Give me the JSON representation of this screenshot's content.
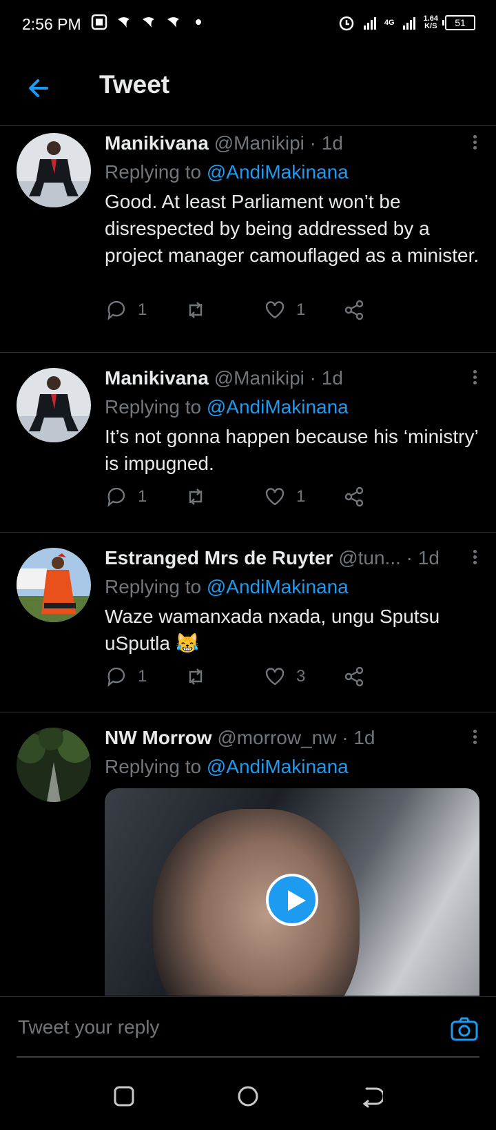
{
  "status_bar": {
    "time": "2:56 PM",
    "network": "4G",
    "speed_value": "1.64",
    "speed_unit": "K/S",
    "battery": "51"
  },
  "header": {
    "title": "Tweet"
  },
  "tweets": [
    {
      "name": "Manikivana",
      "handle": "@Manikipi",
      "sep": "·",
      "time": "1d",
      "replying_prefix": "Replying to",
      "replying_to": "@AndiMakinana",
      "text": "Good. At least Parliament won’t be disrespected by being addressed by a project manager camouflaged as a minister.",
      "replies": "1",
      "retweets": "",
      "likes": "1"
    },
    {
      "name": "Manikivana",
      "handle": "@Manikipi",
      "sep": "·",
      "time": "1d",
      "replying_prefix": "Replying to",
      "replying_to": "@AndiMakinana",
      "text": "It’s not gonna happen because his ‘ministry’ is impugned.",
      "replies": "1",
      "retweets": "",
      "likes": "1"
    },
    {
      "name": "Estranged Mrs de Ruyter",
      "handle": "@tun...",
      "sep": "·",
      "time": "1d",
      "replying_prefix": "Replying to",
      "replying_to": "@AndiMakinana",
      "text": "Waze wamanxada nxada, ungu Sputsu uSputla 😹",
      "replies": "1",
      "retweets": "",
      "likes": "3"
    },
    {
      "name": "NW Morrow",
      "handle": "@morrow_nw",
      "sep": "·",
      "time": "1d",
      "replying_prefix": "Replying to",
      "replying_to": "@AndiMakinana",
      "text": "",
      "media": "video"
    }
  ],
  "compose": {
    "placeholder": "Tweet your reply"
  },
  "colors": {
    "accent": "#1d9bf0",
    "muted": "#71767b",
    "background": "#000000"
  }
}
